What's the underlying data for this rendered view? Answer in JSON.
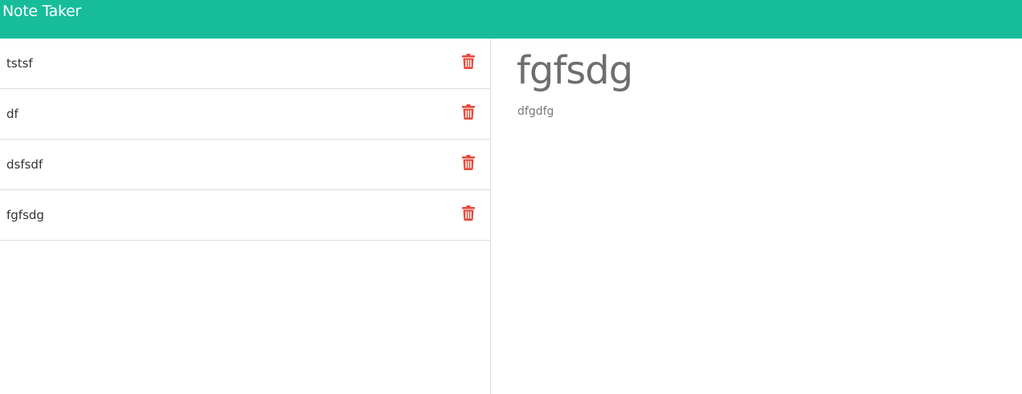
{
  "app": {
    "title": "Note Taker"
  },
  "colors": {
    "navbar": "#17bd9b",
    "delete": "#e5493a",
    "divider": "#dddddd"
  },
  "notes": [
    {
      "title": "tstsf",
      "delete_icon": "trash-icon"
    },
    {
      "title": "df",
      "delete_icon": "trash-icon"
    },
    {
      "title": "dsfsdf",
      "delete_icon": "trash-icon"
    },
    {
      "title": "fgfsdg",
      "delete_icon": "trash-icon"
    }
  ],
  "active_note": {
    "title": "fgfsdg",
    "text": "dfgdfg"
  }
}
